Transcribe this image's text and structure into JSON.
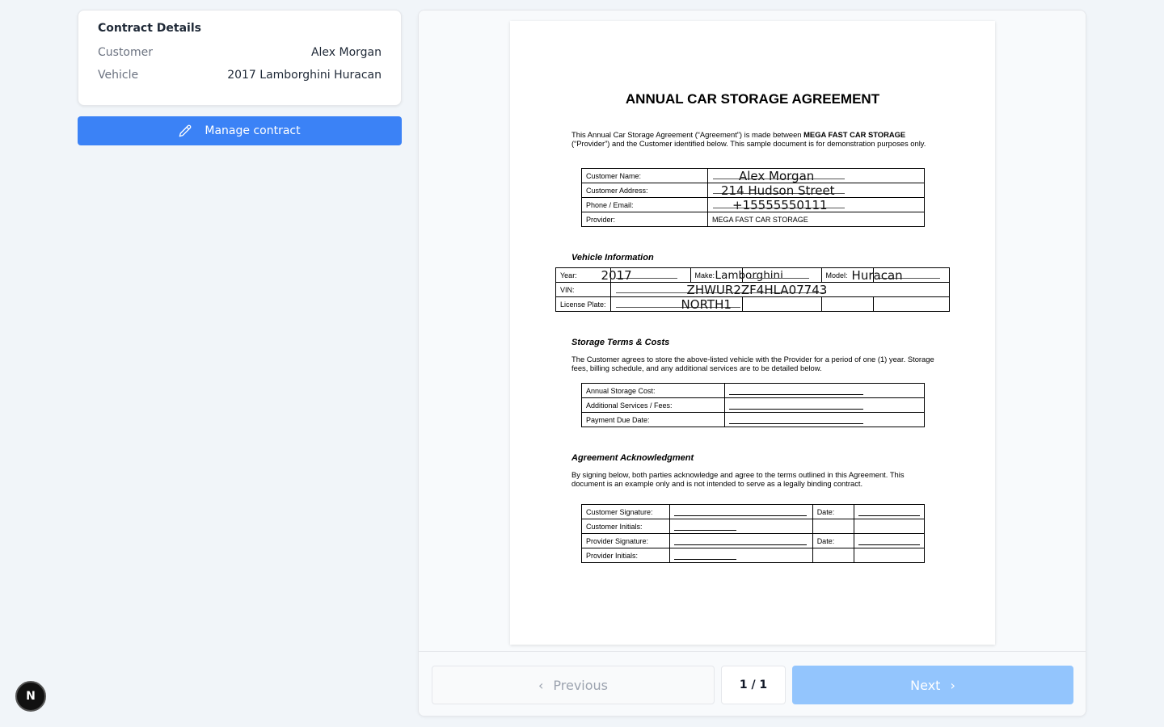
{
  "contract_details": {
    "title": "Contract Details",
    "customer_label": "Customer",
    "customer_value": "Alex Morgan",
    "vehicle_label": "Vehicle",
    "vehicle_value": "2017 Lamborghini Huracan"
  },
  "manage_button": {
    "label": "Manage contract",
    "icon": "pencil-icon",
    "color": "#3b82f6"
  },
  "badge": {
    "letter": "N"
  },
  "document": {
    "title": "ANNUAL CAR STORAGE AGREEMENT",
    "intro_pre": "This Annual Car Storage Agreement (“Agreement”) is made between ",
    "intro_bold": "MEGA FAST CAR STORAGE",
    "intro_post": " (“Provider”) and the Customer identified below. This sample document is for demonstration purposes only.",
    "customer_table": {
      "name_label": "Customer Name:",
      "address_label": "Customer Address:",
      "phone_label": "Phone / Email:",
      "provider_label": "Provider:",
      "name_value": "Alex Morgan",
      "address_value": "214 Hudson Street",
      "phone_value": "+15555550111",
      "provider_value": "MEGA FAST CAR STORAGE"
    },
    "vehicle_heading": "Vehicle Information",
    "vehicle_table": {
      "year_label": "Year:",
      "year_value": "2017",
      "make_label": "Make:",
      "make_value": "Lamborghini",
      "model_label": "Model:",
      "model_value": "Huracan",
      "vin_label": "VIN:",
      "vin_value": "ZHWUR2ZF4HLA07743",
      "plate_label": "License Plate:",
      "plate_value": "NORTH1"
    },
    "storage_heading": "Storage Terms & Costs",
    "storage_text": "The Customer agrees to store the above-listed vehicle with the Provider for a period of one (1) year. Storage fees, billing schedule, and any additional services are to be detailed below.",
    "cost_table": {
      "annual_label": "Annual Storage Cost:",
      "additional_label": "Additional Services / Fees:",
      "due_label": "Payment Due Date:"
    },
    "ack_heading": "Agreement Acknowledgment",
    "ack_text": "By signing below, both parties acknowledge and agree to the terms outlined in this Agreement. This document is an example only and is not intended to serve as a legally binding contract.",
    "sign_table": {
      "cust_sig_label": "Customer Signature:",
      "cust_init_label": "Customer Initials:",
      "prov_sig_label": "Provider Signature:",
      "prov_init_label": "Provider Initials:",
      "date_label": "Date:"
    }
  },
  "pagination": {
    "previous_label": "Previous",
    "next_label": "Next",
    "page_indicator": "1 / 1"
  }
}
